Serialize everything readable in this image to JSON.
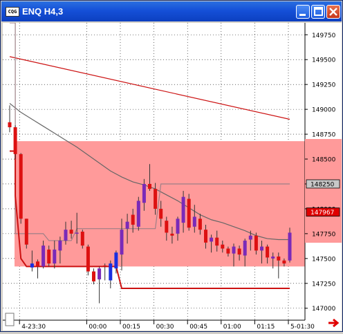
{
  "window": {
    "title": "ENQ H4,3",
    "app_icon_text": "CQG",
    "buttons": [
      "minimize-icon",
      "maximize-icon",
      "close-icon"
    ]
  },
  "chart_data": {
    "type": "candlestick",
    "symbol": "ENQ H4",
    "y_ticks": [
      14700,
      14725,
      14750,
      14775,
      14800,
      14825,
      14850,
      14875,
      14900,
      14925,
      14950,
      14975
    ],
    "y_tick_labels": [
      "147000",
      "147250",
      "147500",
      "147750",
      "148000",
      "148250",
      "148500",
      "148750",
      "149000",
      "149250",
      "149500",
      "149750"
    ],
    "ylim": [
      14688,
      14987
    ],
    "price_markers": [
      {
        "label": "148250",
        "value": 14825,
        "style": "gray"
      },
      {
        "label": "147967",
        "value": 14796.7,
        "style": "red"
      }
    ],
    "x_tick_labels": [
      "4-23:30",
      "00:00",
      "00:15",
      "00:30",
      "00:45",
      "01:00",
      "01:15",
      "5-01:30"
    ],
    "x_tick_index": [
      2,
      14,
      20,
      26,
      32,
      38,
      44,
      50
    ],
    "candles": [
      {
        "o": 14887,
        "h": 14904,
        "l": 14877,
        "c": 14882,
        "color": "red"
      },
      {
        "o": 14882,
        "h": 14884,
        "l": 14850,
        "c": 14855,
        "color": "red"
      },
      {
        "o": 14855,
        "h": 14856,
        "l": 14785,
        "c": 14790,
        "color": "red"
      },
      {
        "o": 14790,
        "h": 14790,
        "l": 14760,
        "c": 14764,
        "color": "red"
      },
      {
        "o": 14745,
        "h": 14758,
        "l": 14737,
        "c": 14741,
        "color": "blue"
      },
      {
        "o": 14747,
        "h": 14749,
        "l": 14730,
        "c": 14742,
        "color": "red"
      },
      {
        "o": 14742,
        "h": 14768,
        "l": 14740,
        "c": 14763,
        "color": "purple"
      },
      {
        "o": 14759,
        "h": 14763,
        "l": 14742,
        "c": 14745,
        "color": "red"
      },
      {
        "o": 14745,
        "h": 14768,
        "l": 14740,
        "c": 14759,
        "color": "purple"
      },
      {
        "o": 14758,
        "h": 14772,
        "l": 14745,
        "c": 14768,
        "color": "purple"
      },
      {
        "o": 14768,
        "h": 14787,
        "l": 14764,
        "c": 14779,
        "color": "purple"
      },
      {
        "o": 14779,
        "h": 14788,
        "l": 14770,
        "c": 14775,
        "color": "red"
      },
      {
        "o": 14775,
        "h": 14796,
        "l": 14765,
        "c": 14776,
        "color": "purple"
      },
      {
        "o": 14777,
        "h": 14779,
        "l": 14760,
        "c": 14763,
        "color": "red"
      },
      {
        "o": 14762,
        "h": 14764,
        "l": 14733,
        "c": 14737,
        "color": "red"
      },
      {
        "o": 14737,
        "h": 14740,
        "l": 14724,
        "c": 14727,
        "color": "red"
      },
      {
        "o": 14729,
        "h": 14742,
        "l": 14705,
        "c": 14740,
        "color": "purple"
      },
      {
        "o": 14742,
        "h": 14745,
        "l": 14728,
        "c": 14743,
        "color": "red"
      },
      {
        "o": 14728,
        "h": 14748,
        "l": 14720,
        "c": 14745,
        "color": "blue"
      },
      {
        "o": 14740,
        "h": 14758,
        "l": 14735,
        "c": 14756,
        "color": "blue"
      },
      {
        "o": 14754,
        "h": 14790,
        "l": 14738,
        "c": 14779,
        "color": "purple"
      },
      {
        "o": 14780,
        "h": 14795,
        "l": 14765,
        "c": 14787,
        "color": "purple"
      },
      {
        "o": 14784,
        "h": 14800,
        "l": 14776,
        "c": 14794,
        "color": "red"
      },
      {
        "o": 14782,
        "h": 14812,
        "l": 14778,
        "c": 14808,
        "color": "purple"
      },
      {
        "o": 14806,
        "h": 14830,
        "l": 14798,
        "c": 14825,
        "color": "purple"
      },
      {
        "o": 14825,
        "h": 14845,
        "l": 14818,
        "c": 14820,
        "color": "red"
      },
      {
        "o": 14820,
        "h": 14826,
        "l": 14794,
        "c": 14800,
        "color": "red"
      },
      {
        "o": 14800,
        "h": 14808,
        "l": 14782,
        "c": 14790,
        "color": "red"
      },
      {
        "o": 14788,
        "h": 14792,
        "l": 14768,
        "c": 14776,
        "color": "red"
      },
      {
        "o": 14775,
        "h": 14782,
        "l": 14765,
        "c": 14773,
        "color": "red"
      },
      {
        "o": 14775,
        "h": 14792,
        "l": 14768,
        "c": 14790,
        "color": "purple"
      },
      {
        "o": 14786,
        "h": 14818,
        "l": 14776,
        "c": 14812,
        "color": "purple"
      },
      {
        "o": 14810,
        "h": 14815,
        "l": 14778,
        "c": 14781,
        "color": "red"
      },
      {
        "o": 14782,
        "h": 14804,
        "l": 14776,
        "c": 14792,
        "color": "purple"
      },
      {
        "o": 14790,
        "h": 14795,
        "l": 14774,
        "c": 14779,
        "color": "red"
      },
      {
        "o": 14779,
        "h": 14784,
        "l": 14760,
        "c": 14766,
        "color": "red"
      },
      {
        "o": 14767,
        "h": 14774,
        "l": 14756,
        "c": 14771,
        "color": "purple"
      },
      {
        "o": 14771,
        "h": 14778,
        "l": 14757,
        "c": 14763,
        "color": "red"
      },
      {
        "o": 14764,
        "h": 14768,
        "l": 14756,
        "c": 14760,
        "color": "red"
      },
      {
        "o": 14760,
        "h": 14762,
        "l": 14752,
        "c": 14755,
        "color": "red"
      },
      {
        "o": 14755,
        "h": 14765,
        "l": 14742,
        "c": 14762,
        "color": "purple"
      },
      {
        "o": 14760,
        "h": 14763,
        "l": 14748,
        "c": 14754,
        "color": "red"
      },
      {
        "o": 14753,
        "h": 14770,
        "l": 14742,
        "c": 14768,
        "color": "purple"
      },
      {
        "o": 14769,
        "h": 14778,
        "l": 14758,
        "c": 14773,
        "color": "purple"
      },
      {
        "o": 14773,
        "h": 14776,
        "l": 14754,
        "c": 14758,
        "color": "red"
      },
      {
        "o": 14758,
        "h": 14768,
        "l": 14745,
        "c": 14762,
        "color": "purple"
      },
      {
        "o": 14762,
        "h": 14764,
        "l": 14745,
        "c": 14751,
        "color": "red"
      },
      {
        "o": 14750,
        "h": 14756,
        "l": 14740,
        "c": 14752,
        "color": "purple"
      },
      {
        "o": 14752,
        "h": 14756,
        "l": 14730,
        "c": 14748,
        "color": "red"
      },
      {
        "o": 14748,
        "h": 14750,
        "l": 14742,
        "c": 14745,
        "color": "red"
      },
      {
        "o": 14748,
        "h": 14781,
        "l": 14746,
        "c": 14776,
        "color": "purple"
      }
    ],
    "band": {
      "from": 14742,
      "to": 14868,
      "color": "#ff9a9a"
    },
    "overlays": [
      {
        "name": "upper-red-line",
        "color": "#cc1111",
        "points": [
          [
            0,
            14953
          ],
          [
            50,
            14890
          ]
        ]
      },
      {
        "name": "thin-average",
        "color": "#666666",
        "points": [
          [
            0,
            14906
          ],
          [
            2,
            14897
          ],
          [
            4,
            14890
          ],
          [
            6,
            14883
          ],
          [
            8,
            14876
          ],
          [
            10,
            14869
          ],
          [
            12,
            14862
          ],
          [
            14,
            14854
          ],
          [
            16,
            14846
          ],
          [
            18,
            14838
          ],
          [
            20,
            14832
          ],
          [
            22,
            14827
          ],
          [
            24,
            14824
          ],
          [
            26,
            14820
          ],
          [
            28,
            14814
          ],
          [
            30,
            14808
          ],
          [
            32,
            14801
          ],
          [
            34,
            14794
          ],
          [
            36,
            14789
          ],
          [
            38,
            14786
          ],
          [
            40,
            14782
          ],
          [
            42,
            14778
          ],
          [
            44,
            14773
          ],
          [
            46,
            14770
          ],
          [
            48,
            14769
          ],
          [
            50,
            14769
          ]
        ]
      },
      {
        "name": "gray-step",
        "color": "#9c7f86",
        "points": [
          [
            0,
            14987
          ],
          [
            1,
            14987
          ],
          [
            1,
            14775
          ],
          [
            6,
            14775
          ],
          [
            7,
            14768
          ],
          [
            11,
            14768
          ],
          [
            12,
            14780
          ],
          [
            26,
            14780
          ],
          [
            27,
            14825
          ],
          [
            50,
            14825
          ]
        ]
      },
      {
        "name": "red-step",
        "color": "#cc1111",
        "points": [
          [
            0,
            14858
          ],
          [
            1,
            14858
          ],
          [
            1,
            14813
          ],
          [
            2,
            14750
          ],
          [
            3,
            14742
          ],
          [
            19,
            14742
          ],
          [
            20,
            14720
          ],
          [
            50,
            14720
          ]
        ]
      }
    ]
  }
}
